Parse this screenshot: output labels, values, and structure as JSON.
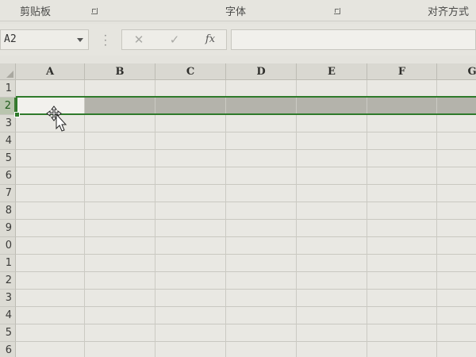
{
  "ribbon": {
    "clipboard": "剪贴板",
    "font": "字体",
    "alignment": "对齐方式"
  },
  "formula_bar": {
    "name_box": "A2",
    "formula": "",
    "cancel_icon": "✕",
    "enter_icon": "✓",
    "fx_label": "fx"
  },
  "sheet": {
    "columns": [
      "A",
      "B",
      "C",
      "D",
      "E",
      "F",
      "G"
    ],
    "rows": [
      "1",
      "2",
      "3",
      "4",
      "5",
      "6",
      "7",
      "8",
      "9",
      "0",
      "1",
      "2",
      "3",
      "4",
      "5",
      "6"
    ],
    "selected_row": "2",
    "active_cell": "A2"
  },
  "colors": {
    "selection": "#2f7a2b",
    "selected_row_fill": "#b4b3ab"
  }
}
